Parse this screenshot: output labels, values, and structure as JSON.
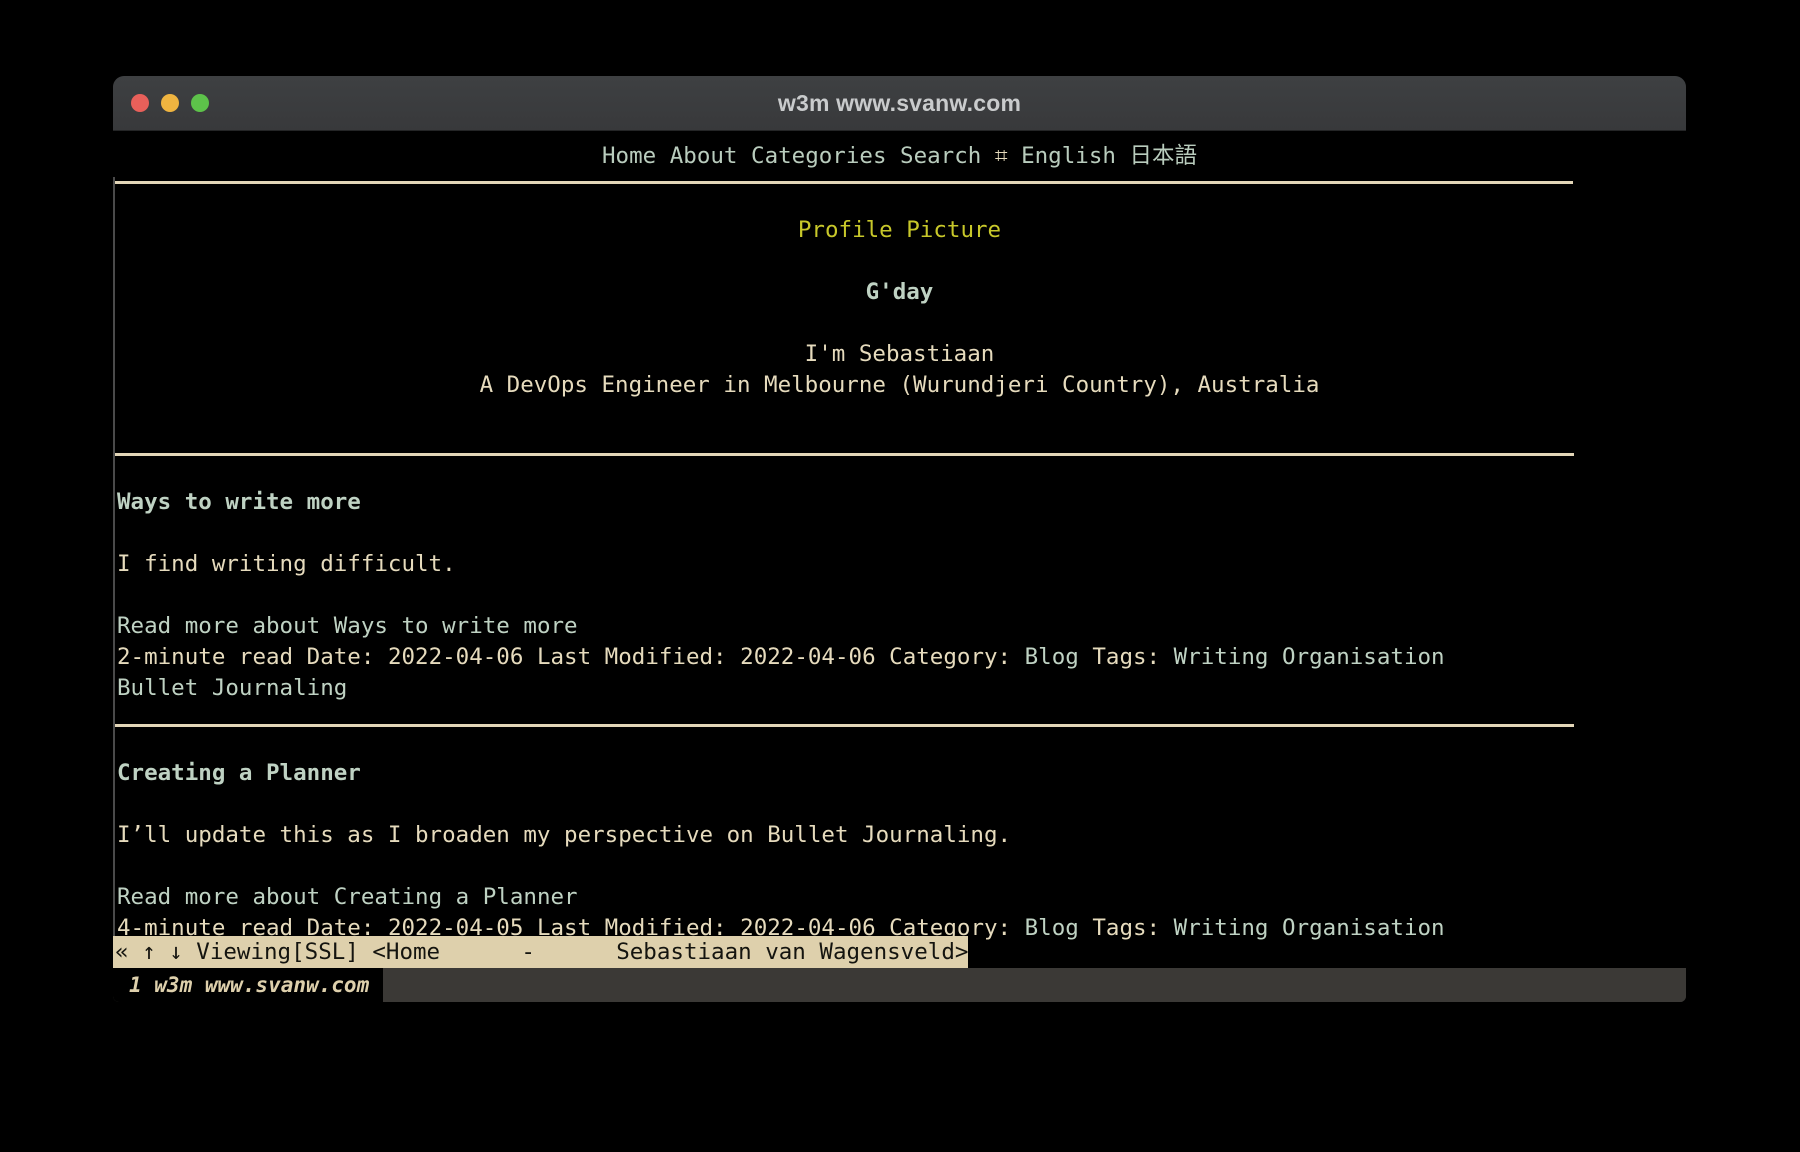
{
  "window": {
    "title": "w3m www.svanw.com",
    "traffic_lights": [
      "close-button",
      "minimize-button",
      "zoom-button"
    ]
  },
  "colors": {
    "background": "#000000",
    "titlebar": "#3e4042",
    "link": "#bfd2c3",
    "text": "#e6dbbd",
    "heading_yellow": "#c8c82a",
    "rule": "#e3d6b8",
    "statusbar_bg": "#ded0ac",
    "statusbar_fg": "#14140f",
    "tmux_bg": "#3b3936",
    "dot_red": "#e8605a",
    "dot_yellow": "#efb440",
    "dot_green": "#5dc24a"
  },
  "nav": {
    "items": [
      "Home",
      "About",
      "Categories",
      "Search"
    ],
    "hash_glyph": "⌗",
    "languages": [
      "English",
      "日本語"
    ],
    "line": "Home About Categories Search ⌗ English 日本語"
  },
  "hero": {
    "profile_picture_alt": "Profile Picture",
    "greeting": "G'day",
    "intro": "I'm Sebastiaan",
    "tagline": "A DevOps Engineer in Melbourne (Wurundjeri Country), Australia"
  },
  "articles": [
    {
      "title": "Ways to write more",
      "excerpt": "I find writing difficult.",
      "read_more_prefix": "Read more about ",
      "read_more_title": "Ways to write more",
      "read_time": "2-minute read",
      "date_label": "Date:",
      "date": "2022-04-06",
      "modified_label": "Last Modified:",
      "modified": "2022-04-06",
      "category_label": "Category:",
      "category": "Blog",
      "tags_label": "Tags:",
      "tags": [
        "Writing",
        "Organisation",
        "Bullet Journaling"
      ],
      "tags_line_1": "Writing Organisation",
      "tags_line_2": "Bullet Journaling"
    },
    {
      "title": "Creating a Planner",
      "excerpt": "I’ll update this as I broaden my perspective on Bullet Journaling.",
      "read_more_prefix": "Read more about ",
      "read_more_title": "Creating a Planner",
      "read_time": "4-minute read",
      "date_label": "Date:",
      "date": "2022-04-05",
      "modified_label": "Last Modified:",
      "modified": "2022-04-06",
      "category_label": "Category:",
      "category": "Blog",
      "tags_label": "Tags:",
      "tags": [
        "Writing",
        "Organisation"
      ],
      "tags_line_1": "Writing Organisation"
    }
  ],
  "statusbar": {
    "nav_glyphs": "« ↑ ↓ ",
    "mode": "Viewing[SSL]",
    "link_target": "<Home      -      Sebastiaan van Wagensveld>",
    "full": "« ↑ ↓ Viewing[SSL] <Home      -      Sebastiaan van Wagensveld>"
  },
  "tmux": {
    "window_index": "1",
    "window_name": "w3m www.svanw.com",
    "window_label": "1 w3m www.svanw.com"
  }
}
